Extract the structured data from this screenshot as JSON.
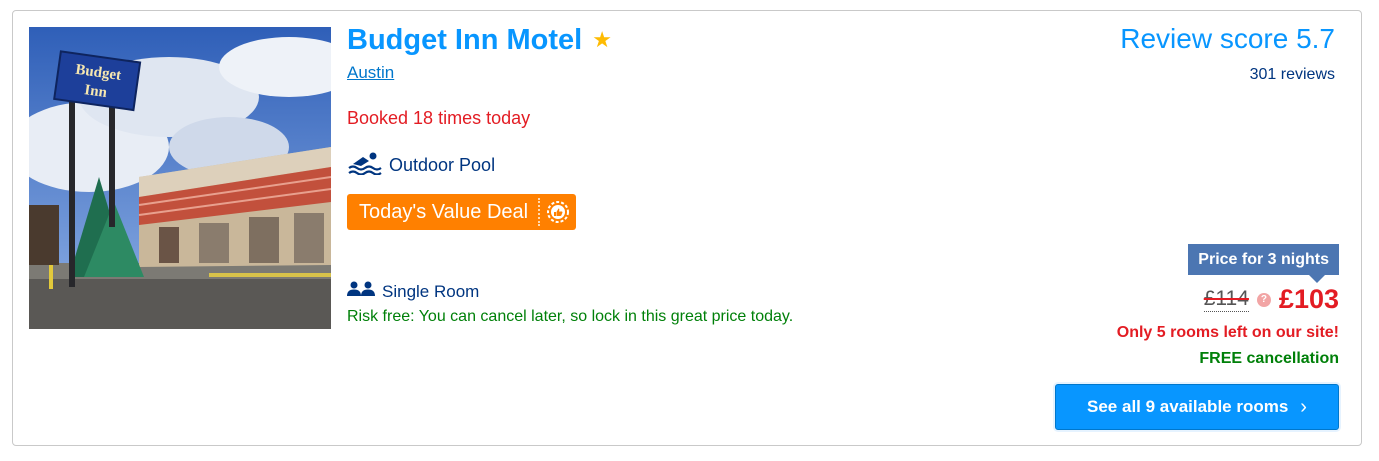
{
  "hotel": {
    "name": "Budget Inn Motel",
    "city": "Austin",
    "booked_text": "Booked 18 times today",
    "facility": "Outdoor Pool",
    "deal_label": "Today's Value Deal",
    "photo_sign_line1": "Budget",
    "photo_sign_line2": "Inn"
  },
  "room": {
    "type": "Single Room",
    "risk_free": "Risk free: You can cancel later, so lock in this great price today."
  },
  "review": {
    "score_text": "Review score 5.7",
    "count_text": "301 reviews"
  },
  "price": {
    "nights_label": "Price for 3 nights",
    "old_price": "£114",
    "new_price": "£103",
    "info_glyph": "?",
    "rooms_left": "Only 5 rooms left on our site!",
    "free_cancellation": "FREE cancellation"
  },
  "cta": {
    "label": "See all 9 available rooms",
    "chevron": "›"
  },
  "icons": {
    "star": "★",
    "colors": {
      "brand_blue": "#0896ff",
      "deal_orange": "#ff8000",
      "urgent_red": "#e31c23",
      "success_green": "#008009",
      "navy": "#003580",
      "star_yellow": "#febb02"
    }
  }
}
